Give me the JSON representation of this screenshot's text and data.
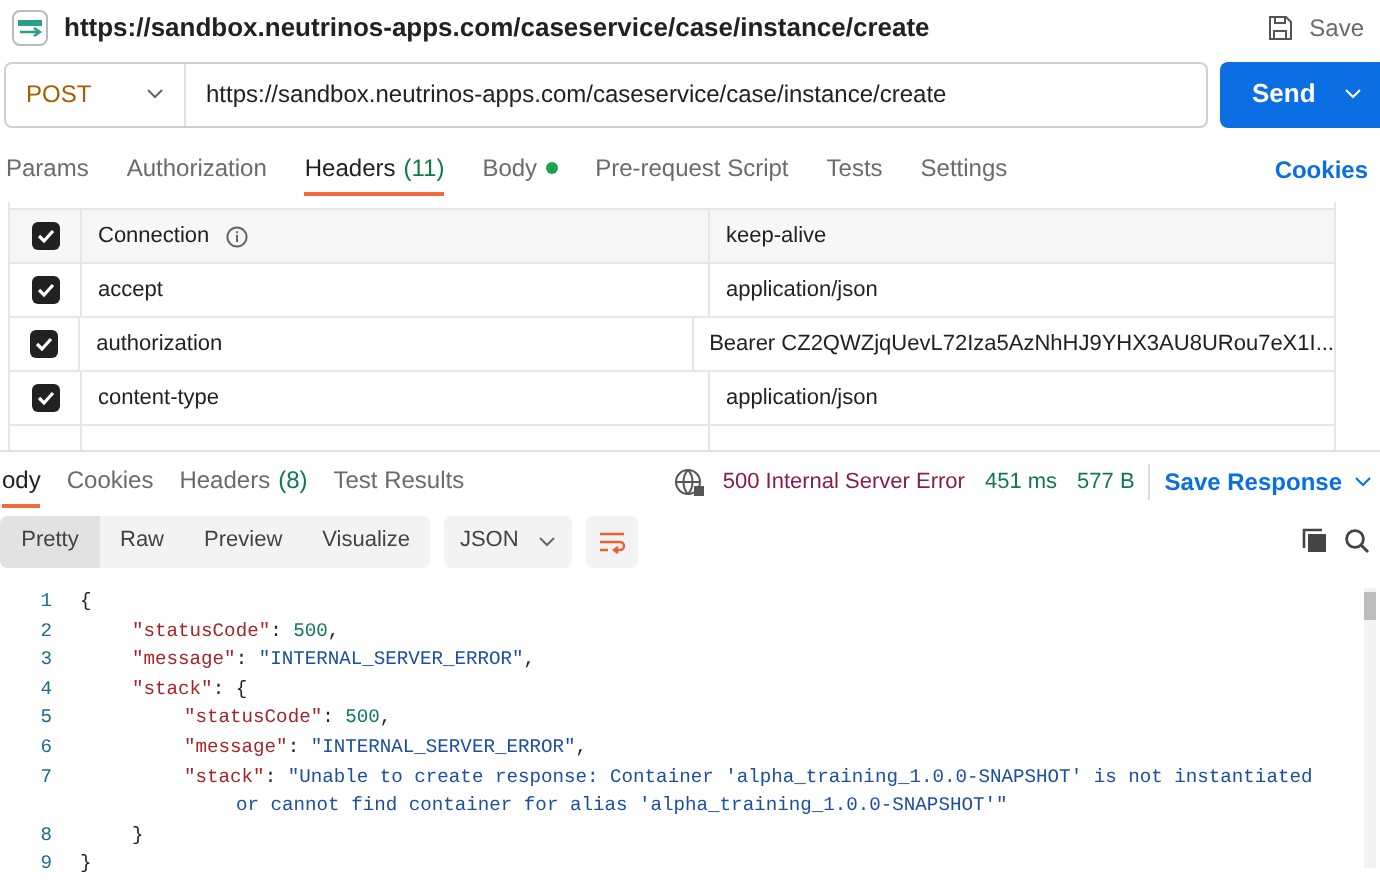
{
  "request": {
    "title": "https://sandbox.neutrinos-apps.com/caseservice/case/instance/create",
    "save_label": "Save",
    "method": "POST",
    "url": "https://sandbox.neutrinos-apps.com/caseservice/case/instance/create",
    "send_label": "Send"
  },
  "request_tabs": [
    {
      "label": "Params",
      "selected": false
    },
    {
      "label": "Authorization",
      "selected": false
    },
    {
      "label": "Headers",
      "count": "(11)",
      "selected": true
    },
    {
      "label": "Body",
      "dot": true,
      "selected": false
    },
    {
      "label": "Pre-request Script",
      "selected": false
    },
    {
      "label": "Tests",
      "selected": false
    },
    {
      "label": "Settings",
      "selected": false
    }
  ],
  "cookies_link": "Cookies",
  "headers": [
    {
      "key": "Connection",
      "info": true,
      "value": "keep-alive",
      "checked": true
    },
    {
      "key": "accept",
      "info": false,
      "value": "application/json",
      "checked": true
    },
    {
      "key": "authorization",
      "info": false,
      "value": "Bearer CZ2QWZjqUevL72Iza5AzNhHJ9YHX3AU8URou7eX1I...",
      "checked": true
    },
    {
      "key": "content-type",
      "info": false,
      "value": "application/json",
      "checked": true
    }
  ],
  "response_tabs": [
    {
      "label": "ody",
      "selected": true
    },
    {
      "label": "Cookies",
      "selected": false
    },
    {
      "label": "Headers",
      "count": "(8)",
      "selected": false
    },
    {
      "label": "Test Results",
      "selected": false
    }
  ],
  "status": {
    "code": "500 Internal Server Error",
    "time": "451 ms",
    "size": "577 B",
    "save_response": "Save Response"
  },
  "view_modes": [
    {
      "label": "Pretty",
      "selected": true
    },
    {
      "label": "Raw",
      "selected": false
    },
    {
      "label": "Preview",
      "selected": false
    },
    {
      "label": "Visualize",
      "selected": false
    }
  ],
  "format": "JSON",
  "code_lines": [
    {
      "number": "1",
      "tokens": [
        {
          "kind": "punct",
          "text": "{"
        }
      ],
      "children": [
        {
          "number": "2",
          "tokens": [
            {
              "kind": "key",
              "text": "\"statusCode\""
            },
            {
              "kind": "punct",
              "text": ": "
            },
            {
              "kind": "number",
              "text": "500"
            },
            {
              "kind": "punct",
              "text": ","
            }
          ]
        },
        {
          "number": "3",
          "tokens": [
            {
              "kind": "key",
              "text": "\"message\""
            },
            {
              "kind": "punct",
              "text": ": "
            },
            {
              "kind": "string",
              "text": "\"INTERNAL_SERVER_ERROR\""
            },
            {
              "kind": "punct",
              "text": ","
            }
          ]
        },
        {
          "number": "4",
          "tokens": [
            {
              "kind": "key",
              "text": "\"stack\""
            },
            {
              "kind": "punct",
              "text": ": {"
            }
          ],
          "children": [
            {
              "number": "5",
              "tokens": [
                {
                  "kind": "key",
                  "text": "\"statusCode\""
                },
                {
                  "kind": "punct",
                  "text": ": "
                },
                {
                  "kind": "number",
                  "text": "500"
                },
                {
                  "kind": "punct",
                  "text": ","
                }
              ]
            },
            {
              "number": "6",
              "tokens": [
                {
                  "kind": "key",
                  "text": "\"message\""
                },
                {
                  "kind": "punct",
                  "text": ": "
                },
                {
                  "kind": "string",
                  "text": "\"INTERNAL_SERVER_ERROR\""
                },
                {
                  "kind": "punct",
                  "text": ","
                }
              ]
            },
            {
              "number": "7",
              "tokens": [
                {
                  "kind": "key",
                  "text": "\"stack\""
                },
                {
                  "kind": "punct",
                  "text": ": "
                },
                {
                  "kind": "string",
                  "text": "\"Unable to create response: Container 'alpha_training_1.0.0-SNAPSHOT' is not instantiated"
                }
              ],
              "children": [
                {
                  "tokens": [
                    {
                      "kind": "string",
                      "text": "or cannot find container for alias 'alpha_training_1.0.0-SNAPSHOT'\""
                    }
                  ]
                }
              ]
            }
          ]
        },
        {
          "number": "8",
          "tokens": [
            {
              "kind": "punct",
              "text": "}"
            }
          ]
        }
      ]
    },
    {
      "number": "9",
      "tokens": [
        {
          "kind": "punct",
          "text": "}"
        }
      ]
    }
  ]
}
